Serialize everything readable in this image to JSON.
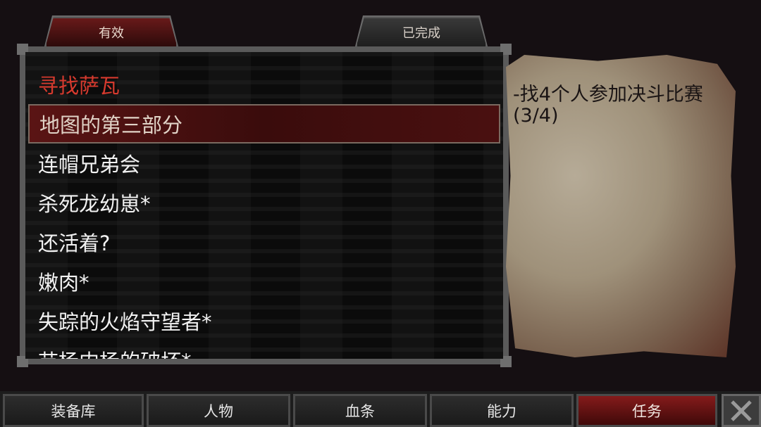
{
  "tabs": {
    "active_label": "有效",
    "completed_label": "已完成"
  },
  "quests": [
    {
      "label": "寻找萨瓦",
      "state": "header"
    },
    {
      "label": "地图的第三部分",
      "state": "selected"
    },
    {
      "label": "连帽兄弟会",
      "state": "normal"
    },
    {
      "label": "杀死龙幼崽*",
      "state": "normal"
    },
    {
      "label": "还活着?",
      "state": "normal"
    },
    {
      "label": "嫩肉*",
      "state": "normal"
    },
    {
      "label": "失踪的火焰守望者*",
      "state": "normal"
    },
    {
      "label": "苗杨内杨的破坏*",
      "state": "normal"
    }
  ],
  "quest_detail": {
    "text": "-找4个人参加决斗比赛 (3/4)"
  },
  "nav": {
    "items": [
      "装备库",
      "人物",
      "血条",
      "能力",
      "任务"
    ],
    "active": "任务",
    "close_icon": "close-x-icon"
  },
  "colors": {
    "accent_red": "#d63a2e",
    "selected_bg": "#5a1414",
    "active_nav": "#8a1c1c"
  }
}
